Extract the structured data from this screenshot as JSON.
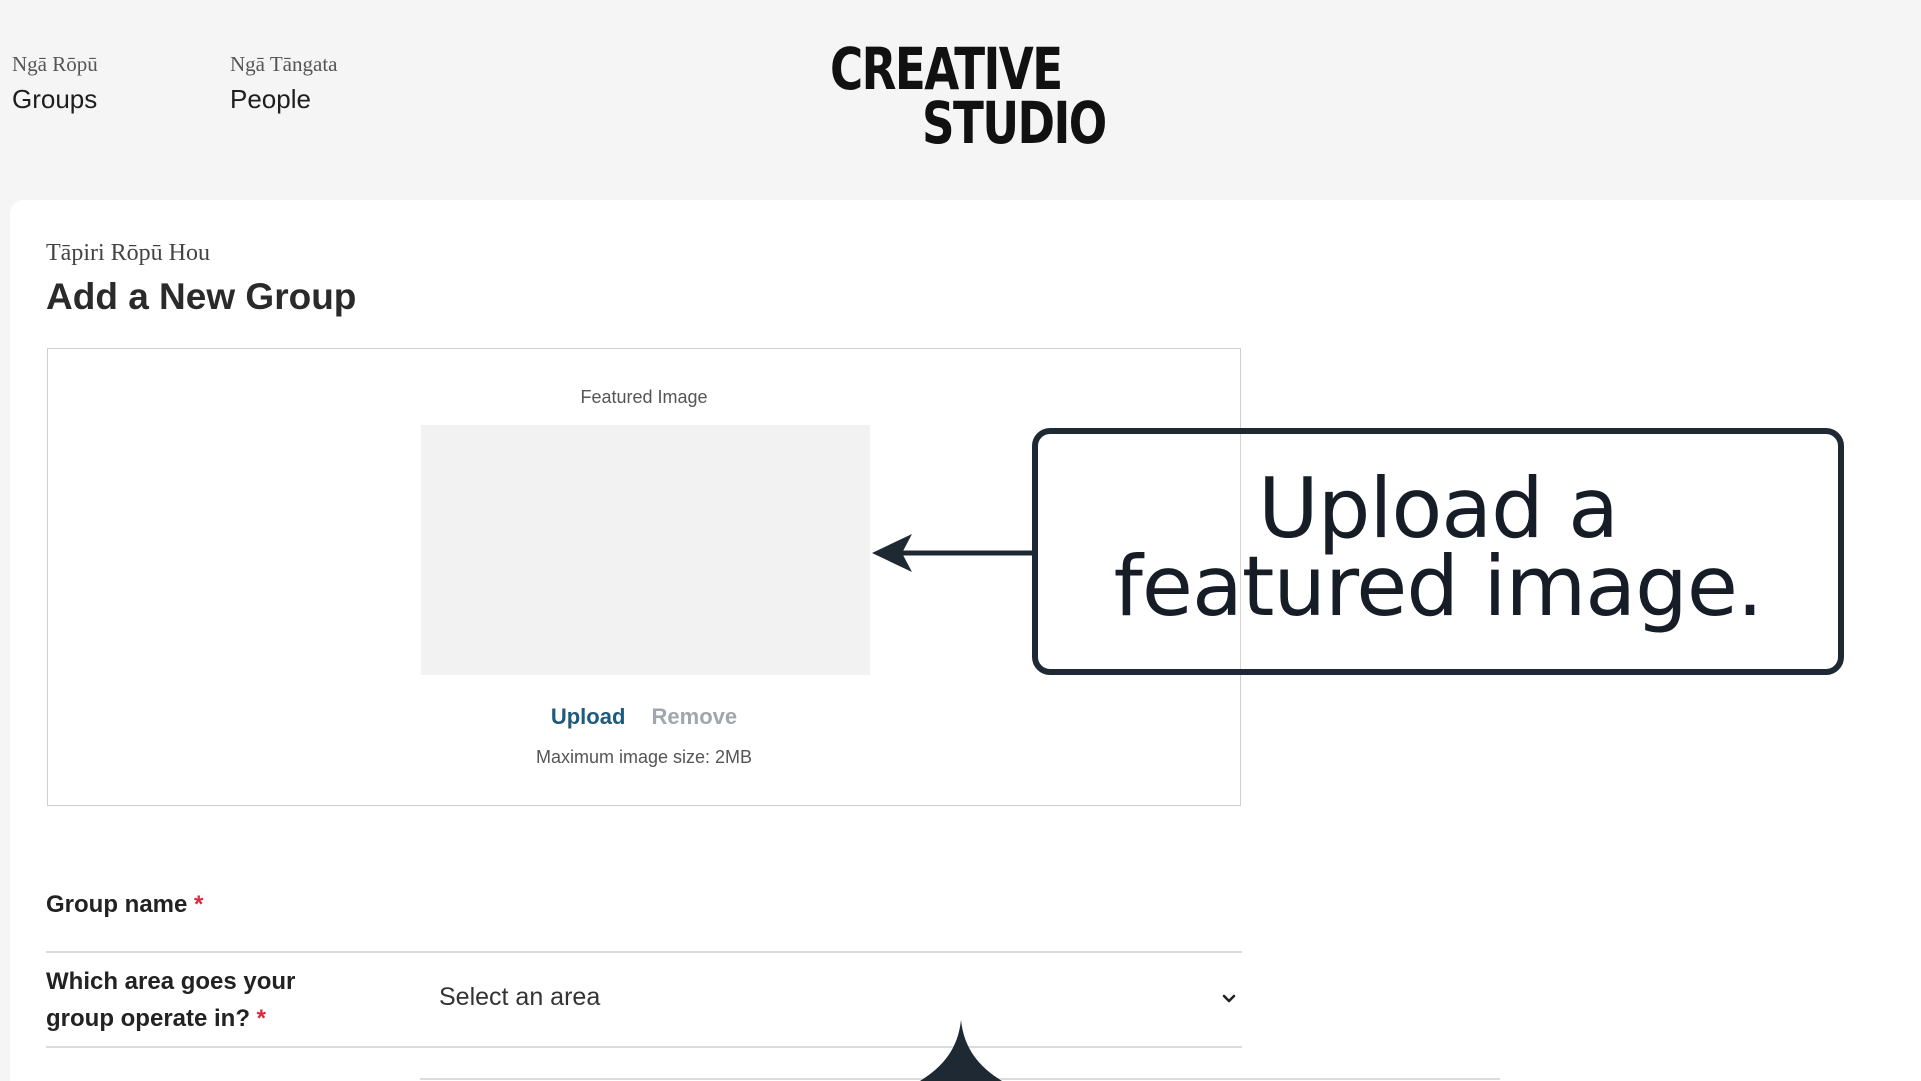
{
  "nav": {
    "groups": {
      "sub": "Ngā Rōpū",
      "label": "Groups"
    },
    "people": {
      "sub": "Ngā Tāngata",
      "label": "People"
    }
  },
  "logo": {
    "line1": "CREATIVE",
    "line2": "STUDIO"
  },
  "page": {
    "subtitle": "Tāpiri Rōpū Hou",
    "title": "Add a New Group"
  },
  "featured_image": {
    "label": "Featured Image",
    "upload": "Upload",
    "remove": "Remove",
    "max_size": "Maximum image size: 2MB"
  },
  "form": {
    "group_name_label": "Group name",
    "area_label": "Which area goes your group operate in?",
    "required_mark": "*",
    "area_select_value": "Select an area"
  },
  "callout": {
    "line1": "Upload a",
    "line2": "featured image."
  },
  "colors": {
    "link": "#1e5a7d",
    "muted_link": "#a1a6ad",
    "required": "#d62b3c",
    "callout_border": "#1f2933"
  },
  "icons": {
    "select_chevron": "chevron-down-icon",
    "callout_arrow": "arrow-left-icon",
    "pointer": "pointer-up-icon"
  }
}
